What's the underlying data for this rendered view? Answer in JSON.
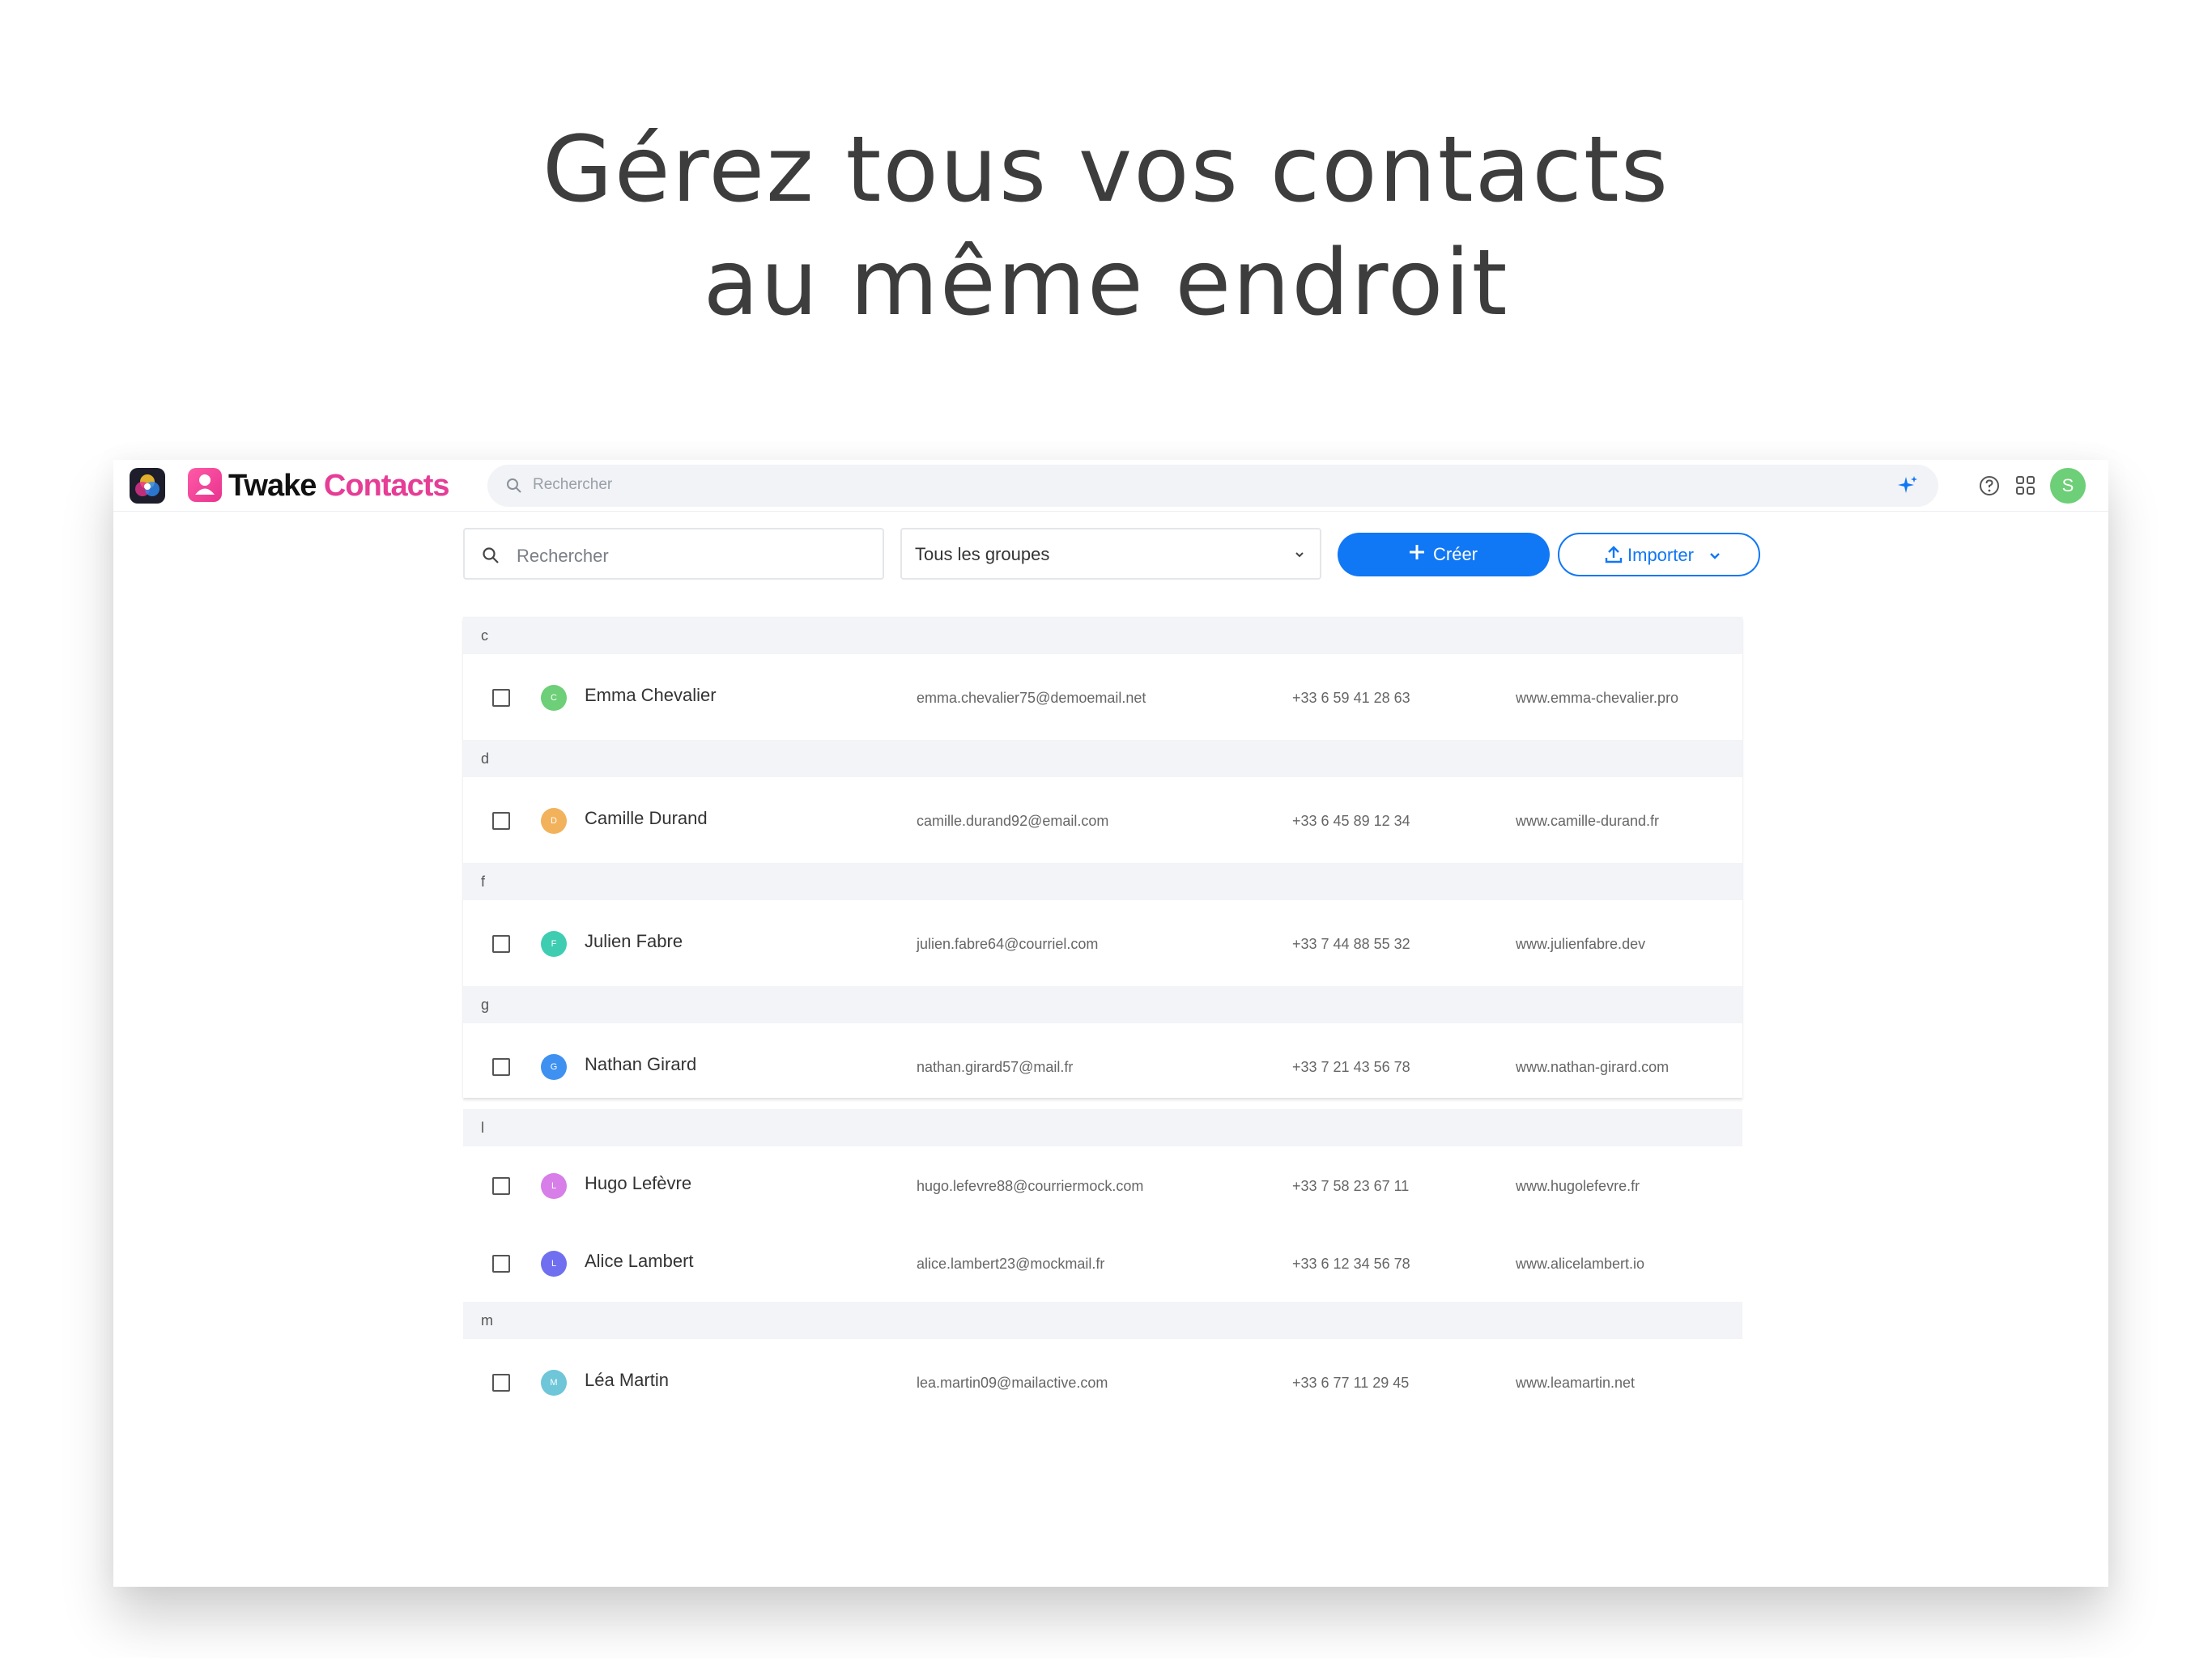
{
  "headline": {
    "line1": "Gérez tous vos contacts",
    "line2": "au même endroit"
  },
  "topbar": {
    "brand_part1": "Twake",
    "brand_part2": "Contacts",
    "search_placeholder": "Rechercher",
    "user_initial": "S"
  },
  "toolbar": {
    "search_placeholder": "Rechercher",
    "group_selected": "Tous les groupes",
    "create_label": "Créer",
    "import_label": "Importer"
  },
  "groups": [
    {
      "letter": "c",
      "contacts": [
        {
          "initial": "C",
          "color": "#6dcf77",
          "name": "Emma Chevalier",
          "email": "emma.chevalier75@demoemail.net",
          "phone": "+33 6 59 41 28 63",
          "web": "www.emma-chevalier.pro"
        }
      ]
    },
    {
      "letter": "d",
      "contacts": [
        {
          "initial": "D",
          "color": "#f2b25c",
          "name": "Camille Durand",
          "email": "camille.durand92@email.com",
          "phone": "+33 6 45 89 12 34",
          "web": "www.camille-durand.fr"
        }
      ]
    },
    {
      "letter": "f",
      "contacts": [
        {
          "initial": "F",
          "color": "#3fcdb2",
          "name": "Julien Fabre",
          "email": "julien.fabre64@courriel.com",
          "phone": "+33 7 44 88 55 32",
          "web": "www.julienfabre.dev"
        }
      ]
    },
    {
      "letter": "g",
      "contacts": [
        {
          "initial": "G",
          "color": "#3e91f0",
          "name": "Nathan Girard",
          "email": "nathan.girard57@mail.fr",
          "phone": "+33 7 21 43 56 78",
          "web": "www.nathan-girard.com"
        }
      ]
    },
    {
      "letter": "l",
      "contacts": [
        {
          "initial": "L",
          "color": "#d77ee8",
          "name": "Hugo Lefèvre",
          "email": "hugo.lefevre88@courriermock.com",
          "phone": "+33 7 58 23 67 11",
          "web": "www.hugolefevre.fr"
        },
        {
          "initial": "L",
          "color": "#6f6ff0",
          "name": "Alice Lambert",
          "email": "alice.lambert23@mockmail.fr",
          "phone": "+33 6 12 34 56 78",
          "web": "www.alicelambert.io"
        }
      ]
    },
    {
      "letter": "m",
      "contacts": [
        {
          "initial": "M",
          "color": "#6ec6d8",
          "name": "Léa Martin",
          "email": "lea.martin09@mailactive.com",
          "phone": "+33 6 77 11 29 45",
          "web": "www.leamartin.net"
        }
      ]
    }
  ]
}
